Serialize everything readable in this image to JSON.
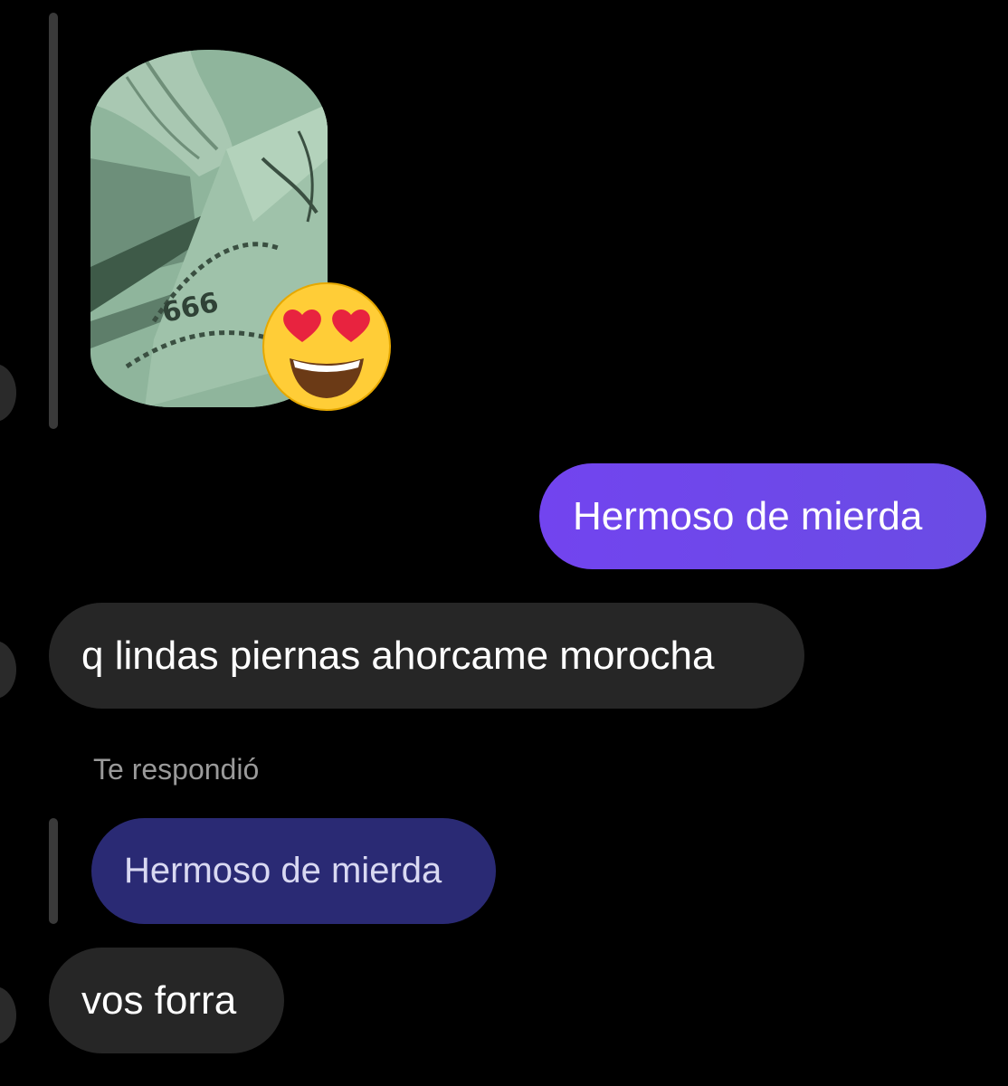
{
  "thread": {
    "story_reply": {
      "image_label": "story-photo",
      "reaction_emoji": "😍"
    },
    "messages": [
      {
        "id": "m1",
        "type": "sent",
        "text": "Hermoso de mierda"
      },
      {
        "id": "m2",
        "type": "received",
        "text": "q lindas piernas ahorcame morocha"
      },
      {
        "id": "m3",
        "type": "reply_context",
        "label": "Te respondió",
        "quoted_text": "Hermoso de mierda"
      },
      {
        "id": "m4",
        "type": "received",
        "text": "vos forra"
      }
    ]
  },
  "colors": {
    "background": "#000000",
    "sent_bubble": "#6a4ce4",
    "received_bubble": "#262626",
    "quoted_bubble": "#2a2a74",
    "meta_text": "#9a9a9a"
  }
}
